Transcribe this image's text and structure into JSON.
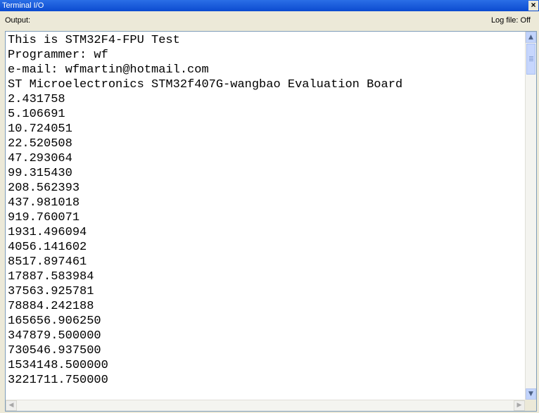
{
  "window": {
    "title": "Terminal I/O",
    "close_glyph": "×"
  },
  "toolbar": {
    "output_label": "Output:",
    "log_file_label": "Log file: Off"
  },
  "output_lines": [
    "This is STM32F4-FPU Test",
    "Programmer: wf",
    "e-mail: wfmartin@hotmail.com",
    "ST Microelectronics STM32f407G-wangbao Evaluation Board",
    "2.431758",
    "5.106691",
    "10.724051",
    "22.520508",
    "47.293064",
    "99.315430",
    "208.562393",
    "437.981018",
    "919.760071",
    "1931.496094",
    "4056.141602",
    "8517.897461",
    "17887.583984",
    "37563.925781",
    "78884.242188",
    "165656.906250",
    "347879.500000",
    "730546.937500",
    "1534148.500000",
    "3221711.750000"
  ],
  "scroll_icons": {
    "up": "chevron-up-icon",
    "down": "chevron-down-icon",
    "left": "chevron-left-icon",
    "right": "chevron-right-icon"
  }
}
